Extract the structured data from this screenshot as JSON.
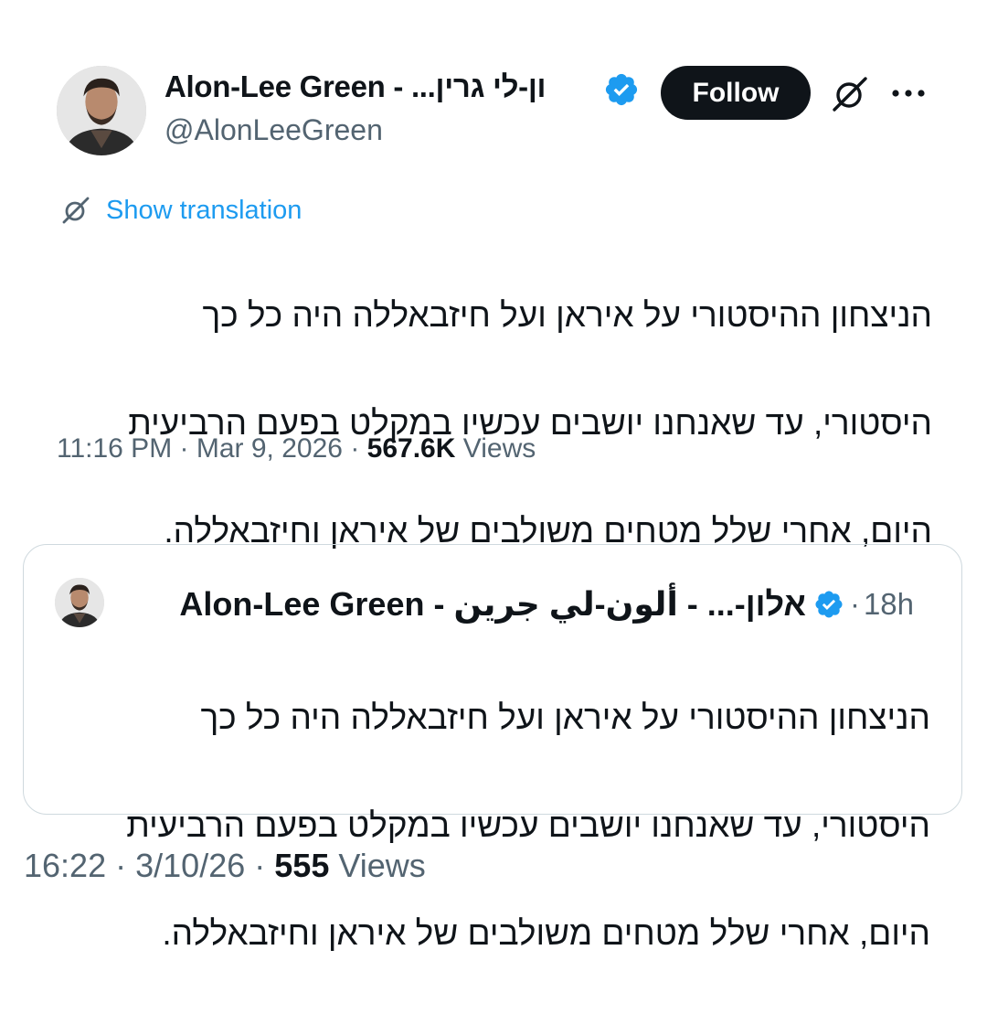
{
  "author": {
    "display_name": "Alon-Lee Green - אלון-לי גרין",
    "display_name_truncated": "Alon-Lee Green - ...ון-לי גרין",
    "handle": "@AlonLeeGreen",
    "verified": true
  },
  "actions": {
    "follow_label": "Follow",
    "grok_icon": "grok-icon",
    "more_icon": "more-icon"
  },
  "translation": {
    "label": "Show translation",
    "icon": "translate-icon"
  },
  "tweet": {
    "text_lines": [
      "הניצחון ההיסטורי על איראן ועל חיזבאללה היה כל כך",
      "היסטורי, עד שאנחנו יושבים עכשיו במקלט בפעם הרביעית",
      "היום, אחרי שלל מטחים משולבים של איראן וחיזבאללה."
    ],
    "time": "11:16 PM",
    "date": "Mar 9, 2026",
    "separator": "·",
    "views_count": "567.6K",
    "views_label": "Views"
  },
  "quote": {
    "display_name": "Alon-Lee Green - אלון-... - ألون-لي جرين",
    "time": "18h",
    "separator": "·",
    "text_lines": [
      "הניצחון ההיסטורי על איראן ועל חיזבאללה היה כל כך",
      "היסטורי, עד שאנחנו יושבים עכשיו במקלט בפעם הרביעית",
      "היום, אחרי שלל מטחים משולבים של איראן וחיזבאללה."
    ]
  },
  "footer": {
    "time": "16:22",
    "date": "3/10/26",
    "separator": "·",
    "views_count": "555",
    "views_label": "Views"
  },
  "colors": {
    "text": "#0f1419",
    "secondary": "#536471",
    "link": "#1d9bf0",
    "verified": "#1d9bf0",
    "button_bg": "#0f1419",
    "border": "#cfd9de"
  }
}
